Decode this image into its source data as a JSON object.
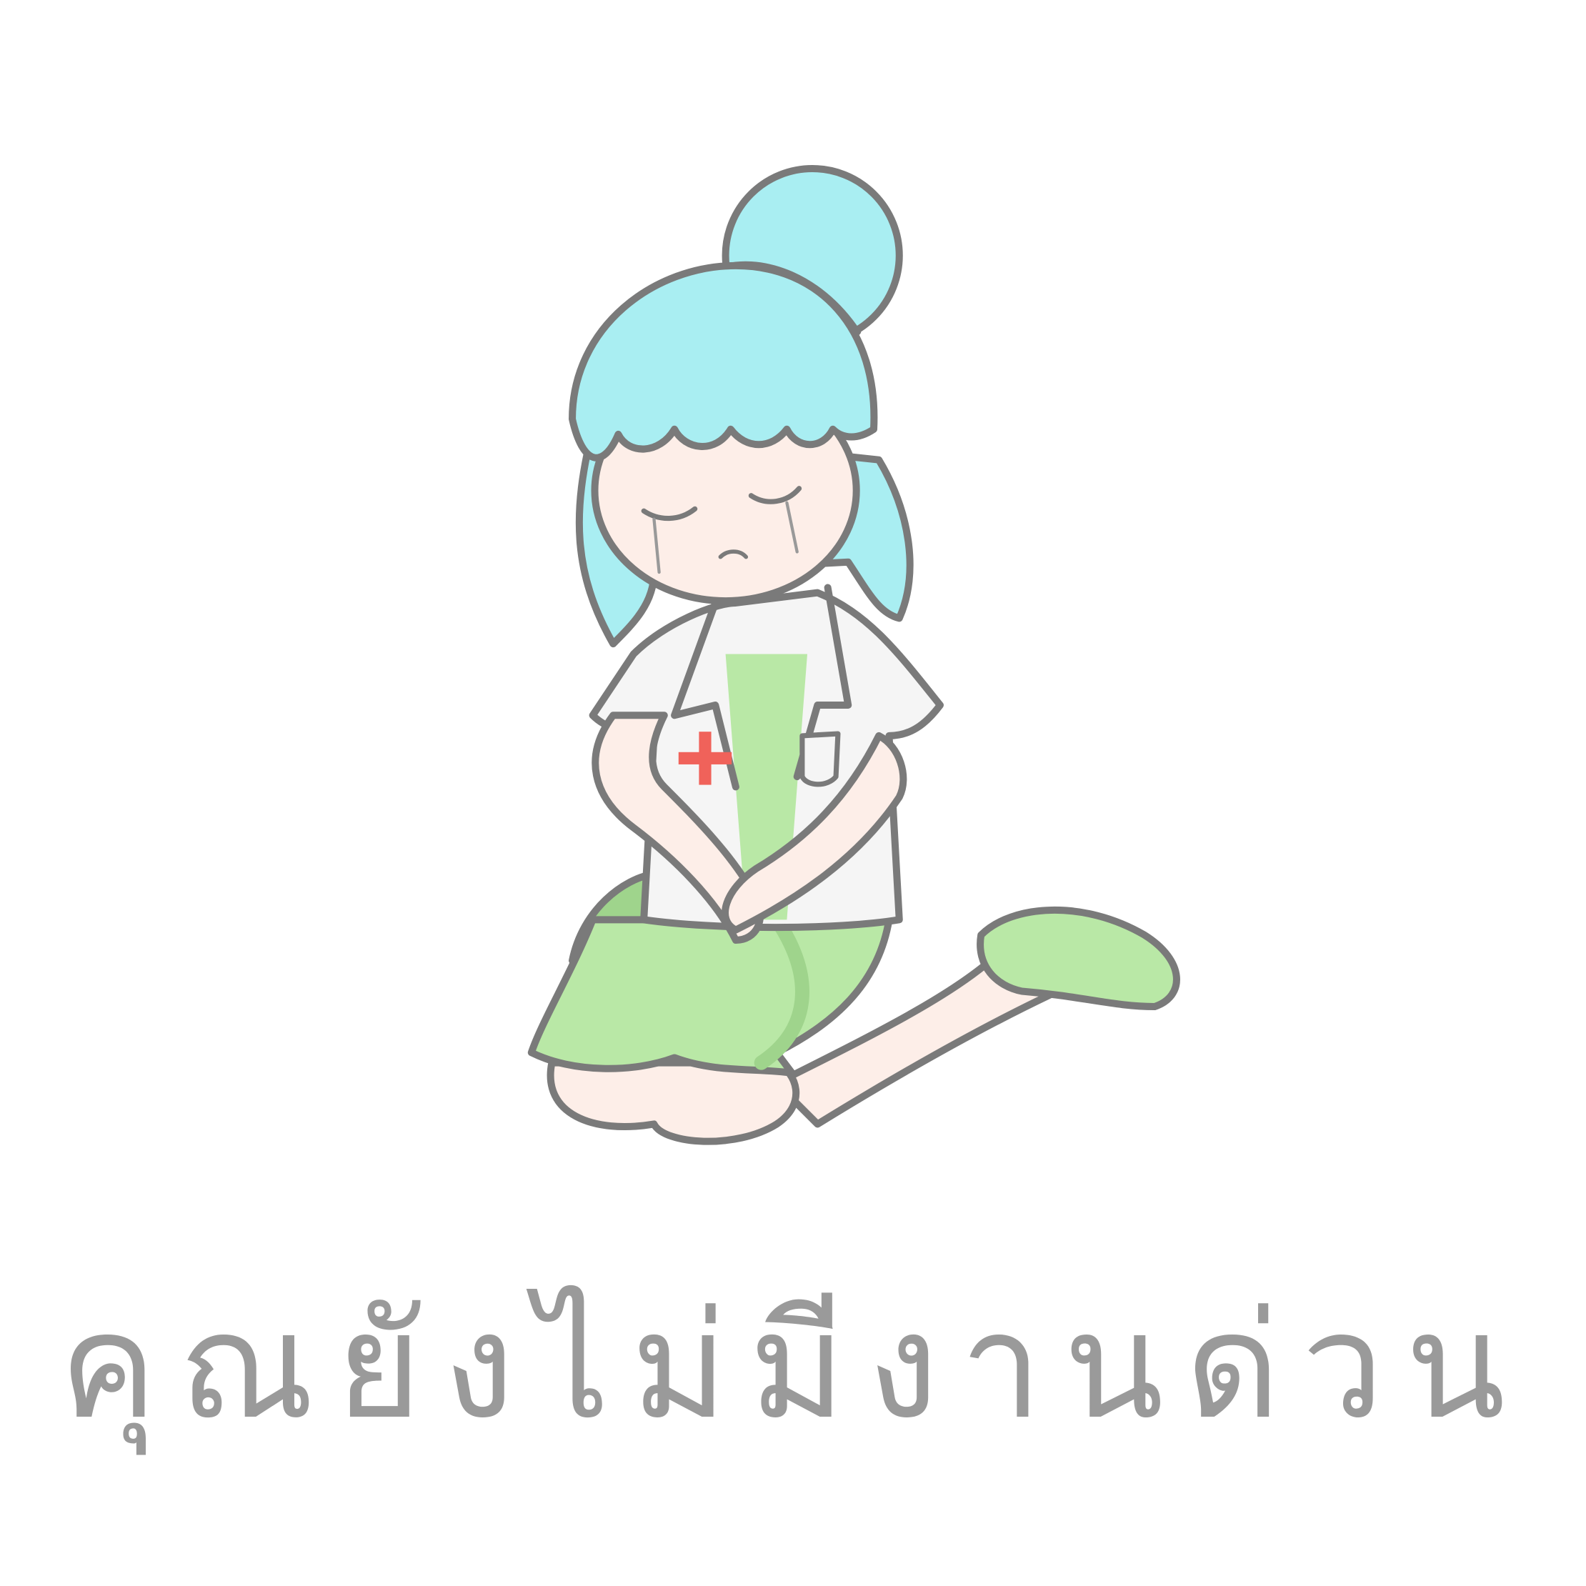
{
  "empty_state": {
    "message": "คุณยังไม่มีงานด่วน",
    "illustration": "crying-nurse-kneeling",
    "colors": {
      "text": "#9a9a9a",
      "hair": "#a9eef2",
      "hair_shade": "#86d9dc",
      "hair_band": "#f07167",
      "dress": "#b9e8a6",
      "dress_shade": "#9fd48c",
      "skin": "#fdeee8",
      "coat": "#f5f5f5",
      "outline": "#7a7a7a",
      "cross": "#f0625a"
    }
  }
}
